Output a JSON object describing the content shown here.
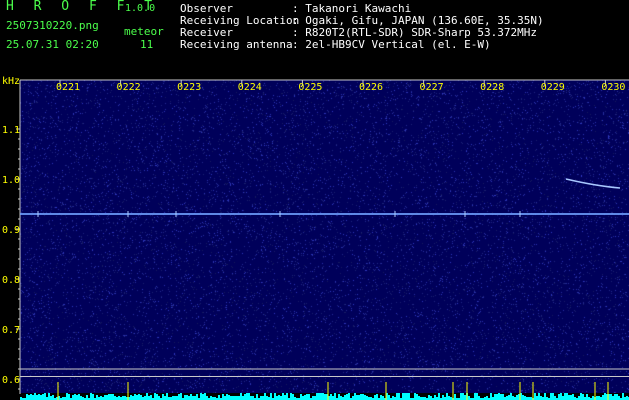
{
  "app": {
    "title": "H R O F F T",
    "version": "1.0.0"
  },
  "file": {
    "name": "2507310220.png",
    "datetime": "25.07.31 02:20"
  },
  "meteor": {
    "label": "meteor",
    "count": "11"
  },
  "meta": {
    "observer_label": "Observer",
    "observer": ": Takanori Kawachi",
    "location_label": "Receiving Location",
    "location": ": Ogaki, Gifu, JAPAN (136.60E, 35.35N)",
    "receiver_label": "Receiver",
    "receiver": ": R820T2(RTL-SDR) SDR-Sharp 53.372MHz",
    "antenna_label": "Receiving antenna",
    "antenna": ": 2el-HB9CV Vertical (el. E-W)"
  },
  "axis": {
    "unit": "kHz",
    "y_ticks": [
      "1.1",
      "1.0",
      "0.9",
      "0.8",
      "0.7",
      "0.6"
    ],
    "x_ticks": [
      "0221",
      "0222",
      "0223",
      "0224",
      "0225",
      "0226",
      "0227",
      "0228",
      "0229",
      "0230"
    ]
  },
  "colors": {
    "bg": "#000000",
    "grid": "#c8c8c8",
    "green": "#4cff4c",
    "yellow": "#ffff00",
    "carrier": "#6fa0ff",
    "meteor": "#a8c8ff",
    "noise": "#1a1aa0",
    "cyan": "#00ffff"
  }
}
